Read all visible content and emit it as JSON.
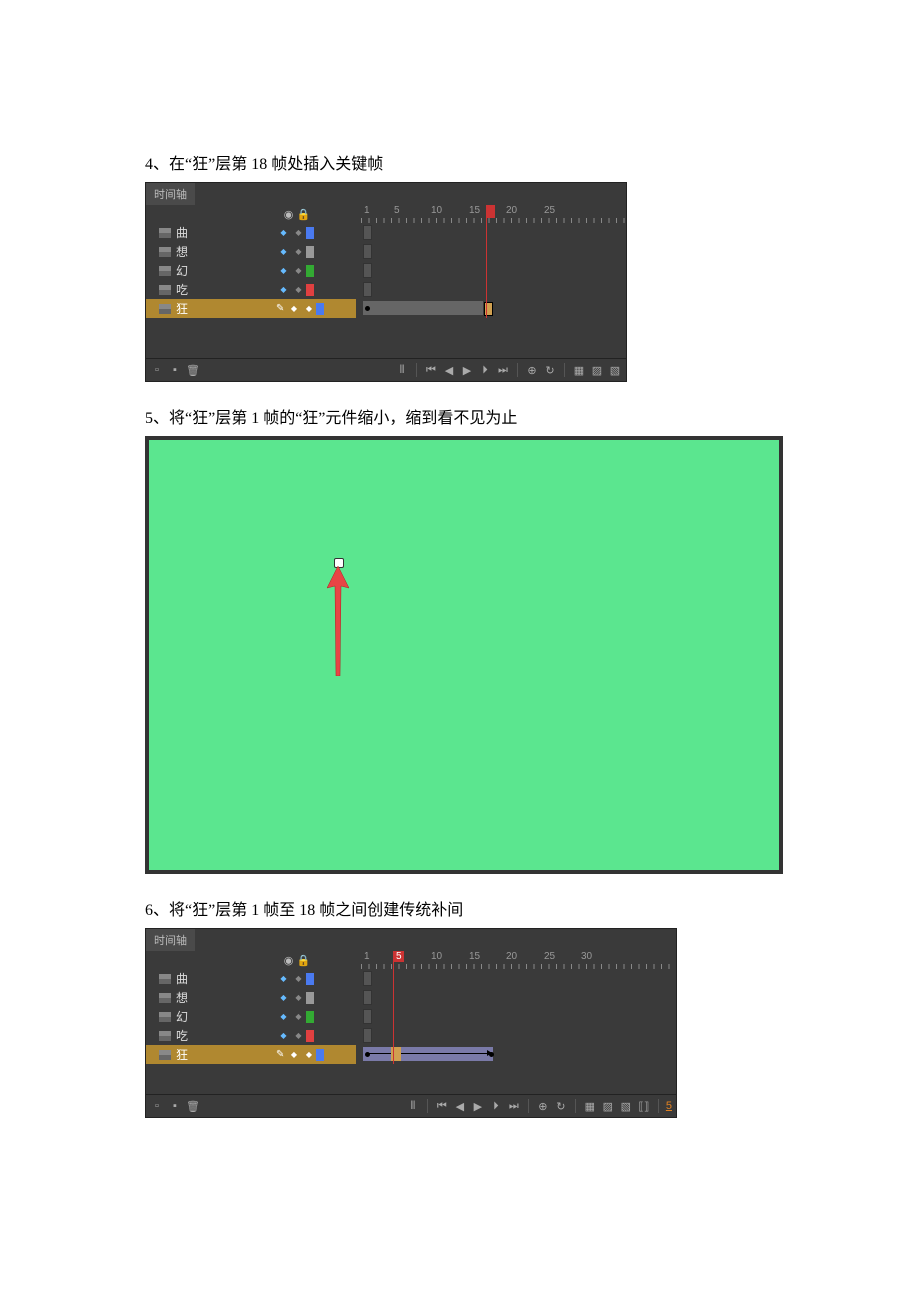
{
  "steps": {
    "s4": "4、在“狂”层第 18 帧处插入关键帧",
    "s5": "5、将“狂”层第 1 帧的“狂”元件缩小，缩到看不见为止",
    "s6": "6、将“狂”层第 1 帧至 18 帧之间创建传统补间"
  },
  "timeline": {
    "tab": "时间轴",
    "layers": [
      {
        "name": "曲",
        "color": "#4a7af0"
      },
      {
        "name": "想",
        "color": "#999"
      },
      {
        "name": "幻",
        "color": "#3a3"
      },
      {
        "name": "吃",
        "color": "#e04040"
      },
      {
        "name": "狂",
        "color": "#4a7af0",
        "selected": true
      }
    ],
    "ruler1": [
      "1",
      "5",
      "10",
      "15",
      "20",
      "25"
    ],
    "ruler2": [
      "1",
      "5",
      "10",
      "15",
      "20",
      "25",
      "30"
    ],
    "frame2_label": "5"
  }
}
